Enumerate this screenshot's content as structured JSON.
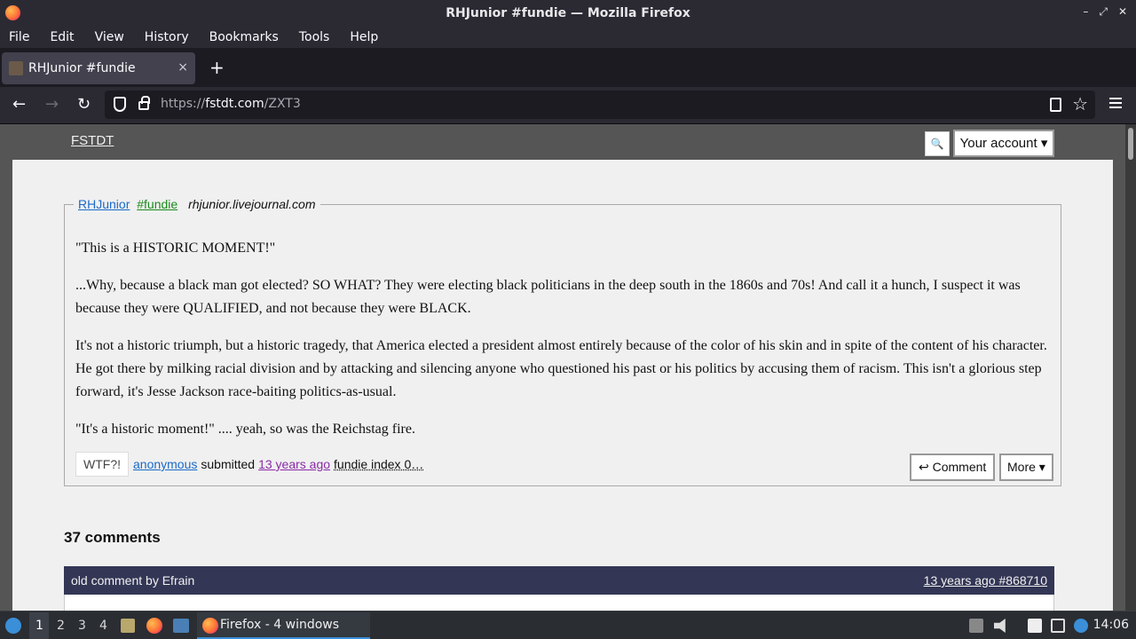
{
  "window": {
    "title": "RHJunior #fundie — Mozilla Firefox",
    "controls": [
      "–",
      "⤢",
      "✕"
    ]
  },
  "menu": [
    "File",
    "Edit",
    "View",
    "History",
    "Bookmarks",
    "Tools",
    "Help"
  ],
  "tab": {
    "title": "RHJunior #fundie",
    "close": "×",
    "new_tab": "+"
  },
  "nav": {
    "back": "←",
    "forward": "→",
    "reload": "↻",
    "url_scheme": "https://",
    "url_host": "fstdt.com",
    "url_path": "/ZXT3",
    "star": "☆"
  },
  "site": {
    "logo": "FSTDT",
    "search_icon": "🔍",
    "account_label": "Your account ▾"
  },
  "quote": {
    "author": "RHJunior",
    "category": "#fundie",
    "source": "rhjunior.livejournal.com",
    "paragraphs": [
      "\"This is a HISTORIC MOMENT!\"",
      "...Why, because a black man got elected? SO WHAT? They were electing black politicians in the deep south in the 1860s and 70s! And call it a hunch, I suspect it was because they were QUALIFIED, and not because they were BLACK.",
      "It's not a historic triumph, but a historic tragedy, that America elected a president almost entirely because of the color of his skin and in spite of the content of his character. He got there by milking racial division and by attacking and silencing anyone who questioned his past or his politics by accusing them of racism. This isn't a glorious step forward, it's Jesse Jackson race-baiting politics-as-usual.",
      "\"It's a historic moment!\" .... yeah, so was the Reichstag fire."
    ],
    "wtf_label": "WTF?!",
    "submitter": "anonymous",
    "submitted_text": "submitted",
    "time_ago": "13 years ago",
    "fundie_index": "fundie index 0…",
    "comment_button": "↩ Comment",
    "more_button": "More ▾"
  },
  "comments": {
    "count_label": "37 comments",
    "first": {
      "byline": "old comment by Efrain",
      "timestamp": "13 years ago #868710"
    }
  },
  "taskbar": {
    "workspaces": [
      "1",
      "2",
      "3",
      "4"
    ],
    "task_label": "Firefox - 4 windows",
    "clock": "14:06"
  }
}
